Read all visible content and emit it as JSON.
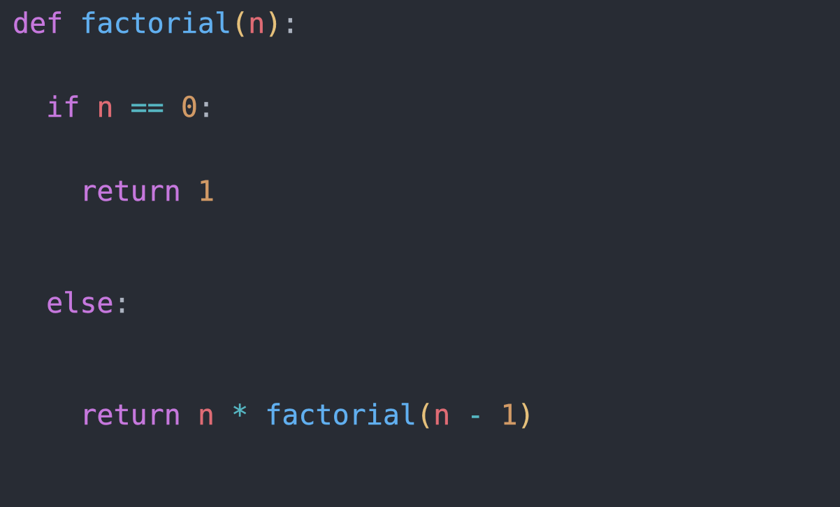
{
  "code": {
    "lines": [
      {
        "tokens": [
          {
            "cls": "tok-kw",
            "text": "def "
          },
          {
            "cls": "tok-fn",
            "text": "factorial"
          },
          {
            "cls": "tok-paren",
            "text": "("
          },
          {
            "cls": "tok-param",
            "text": "n"
          },
          {
            "cls": "tok-paren",
            "text": ")"
          },
          {
            "cls": "tok-colon",
            "text": ":"
          }
        ]
      },
      {
        "tokens": []
      },
      {
        "tokens": []
      },
      {
        "tokens": [
          {
            "cls": "",
            "text": "  "
          },
          {
            "cls": "tok-kw",
            "text": "if "
          },
          {
            "cls": "tok-param",
            "text": "n "
          },
          {
            "cls": "tok-op",
            "text": "== "
          },
          {
            "cls": "tok-num",
            "text": "0"
          },
          {
            "cls": "tok-colon",
            "text": ":"
          }
        ]
      },
      {
        "tokens": []
      },
      {
        "tokens": []
      },
      {
        "tokens": [
          {
            "cls": "",
            "text": "    "
          },
          {
            "cls": "tok-kw",
            "text": "return "
          },
          {
            "cls": "tok-num",
            "text": "1"
          }
        ]
      },
      {
        "tokens": []
      },
      {
        "tokens": []
      },
      {
        "tokens": []
      },
      {
        "tokens": [
          {
            "cls": "",
            "text": "  "
          },
          {
            "cls": "tok-kw",
            "text": "else"
          },
          {
            "cls": "tok-colon",
            "text": ":"
          }
        ]
      },
      {
        "tokens": []
      },
      {
        "tokens": []
      },
      {
        "tokens": []
      },
      {
        "tokens": [
          {
            "cls": "",
            "text": "    "
          },
          {
            "cls": "tok-kw",
            "text": "return "
          },
          {
            "cls": "tok-param",
            "text": "n "
          },
          {
            "cls": "tok-op",
            "text": "* "
          },
          {
            "cls": "tok-fn",
            "text": "factorial"
          },
          {
            "cls": "tok-paren",
            "text": "("
          },
          {
            "cls": "tok-param",
            "text": "n "
          },
          {
            "cls": "tok-op",
            "text": "- "
          },
          {
            "cls": "tok-num",
            "text": "1"
          },
          {
            "cls": "tok-paren",
            "text": ")"
          }
        ]
      }
    ]
  }
}
